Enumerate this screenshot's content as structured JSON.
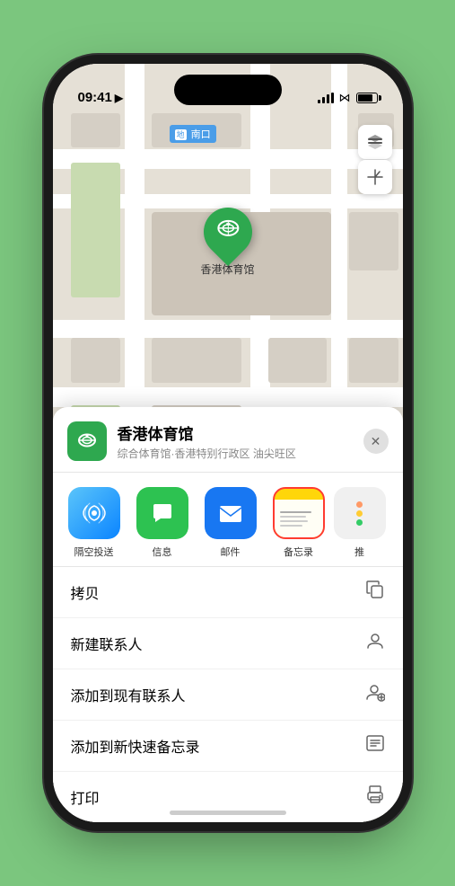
{
  "status_bar": {
    "time": "09:41",
    "location_icon": "▶"
  },
  "map": {
    "label": "南口",
    "label_prefix": "地铁"
  },
  "map_buttons": {
    "layers_icon": "🗺",
    "location_icon": "⬆"
  },
  "stadium": {
    "marker_emoji": "🏟",
    "name": "香港体育馆"
  },
  "venue": {
    "name": "香港体育馆",
    "subtitle": "综合体育馆·香港特别行政区 油尖旺区",
    "close_label": "✕"
  },
  "share_items": [
    {
      "id": "airdrop",
      "label": "隔空投送",
      "emoji": "📡"
    },
    {
      "id": "messages",
      "label": "信息",
      "emoji": "💬"
    },
    {
      "id": "mail",
      "label": "邮件",
      "emoji": "✉️"
    },
    {
      "id": "notes",
      "label": "备忘录",
      "emoji": ""
    },
    {
      "id": "more",
      "label": "推",
      "emoji": ""
    }
  ],
  "action_items": [
    {
      "id": "copy",
      "label": "拷贝",
      "icon": "⧉"
    },
    {
      "id": "new-contact",
      "label": "新建联系人",
      "icon": "👤"
    },
    {
      "id": "add-contact",
      "label": "添加到现有联系人",
      "icon": "👤"
    },
    {
      "id": "quick-note",
      "label": "添加到新快速备忘录",
      "icon": "⬛"
    },
    {
      "id": "print",
      "label": "打印",
      "icon": "🖨"
    }
  ],
  "colors": {
    "green": "#2ea84f",
    "blue": "#1877f2",
    "airdrop_blue": "#0a84ff",
    "notes_yellow": "#ffd60a",
    "notes_border": "#ff3b30",
    "messages_green": "#2dc251"
  }
}
